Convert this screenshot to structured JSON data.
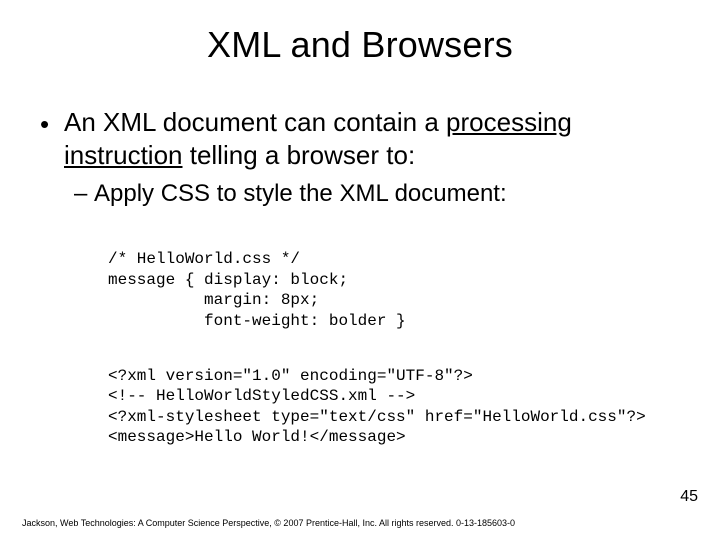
{
  "title": "XML and Browsers",
  "bullet1_pre": "An XML document can contain a ",
  "bullet1_underlined": "processing instruction",
  "bullet1_post": " telling a browser to:",
  "bullet2": "Apply CSS to style the XML document:",
  "code_css_1": "/* HelloWorld.css */",
  "code_css_2": "message { display: block;",
  "code_css_3": "          margin: 8px;",
  "code_css_4": "          font-weight: bolder }",
  "code_xml_1": "<?xml version=\"1.0\" encoding=\"UTF-8\"?>",
  "code_xml_2": "<!-- HelloWorldStyledCSS.xml -->",
  "code_xml_3": "<?xml-stylesheet type=\"text/css\" href=\"HelloWorld.css\"?>",
  "code_xml_4": "<message>Hello World!</message>",
  "page_number": "45",
  "footer": "Jackson, Web Technologies: A Computer Science Perspective, © 2007 Prentice-Hall, Inc. All rights reserved. 0-13-185603-0"
}
